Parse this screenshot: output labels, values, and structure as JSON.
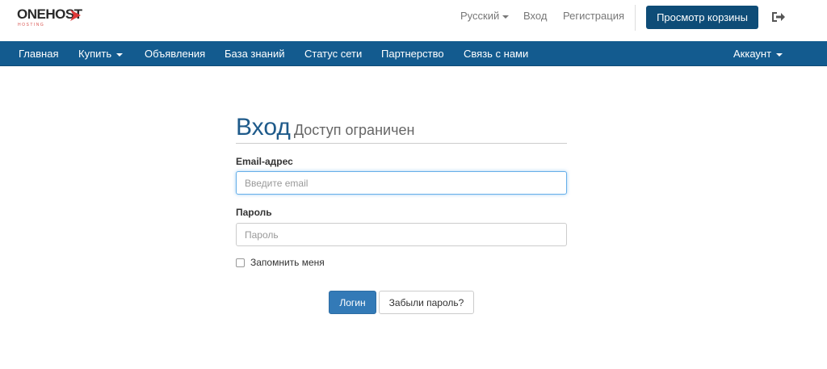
{
  "brand": {
    "name": "ONEHOST",
    "tagline": "HOSTING",
    "logo_icon": "chevron-right-icon",
    "accent_color": "#e03a3a"
  },
  "header": {
    "language": "Русский",
    "login_link": "Вход",
    "register_link": "Регистрация",
    "cart_button": "Просмотр корзины",
    "logout_icon": "sign-out-icon"
  },
  "nav": {
    "items": [
      {
        "label": "Главная"
      },
      {
        "label": "Купить",
        "dropdown": true
      },
      {
        "label": "Объявления"
      },
      {
        "label": "База знаний"
      },
      {
        "label": "Статус сети"
      },
      {
        "label": "Партнерство"
      },
      {
        "label": "Связь с нами"
      }
    ],
    "account": "Аккаунт",
    "bar_color": "#135b8f"
  },
  "login": {
    "title": "Вход",
    "subtitle": "Доступ ограничен",
    "email_label": "Email-адрес",
    "email_placeholder": "Введите email",
    "password_label": "Пароль",
    "password_placeholder": "Пароль",
    "remember_label": "Запомнить меня",
    "submit_button": "Логин",
    "forgot_button": "Забыли пароль?"
  },
  "colors": {
    "primary_button": "#337ab7",
    "cart_button": "#0e4c77",
    "title": "#1e5a8a"
  }
}
